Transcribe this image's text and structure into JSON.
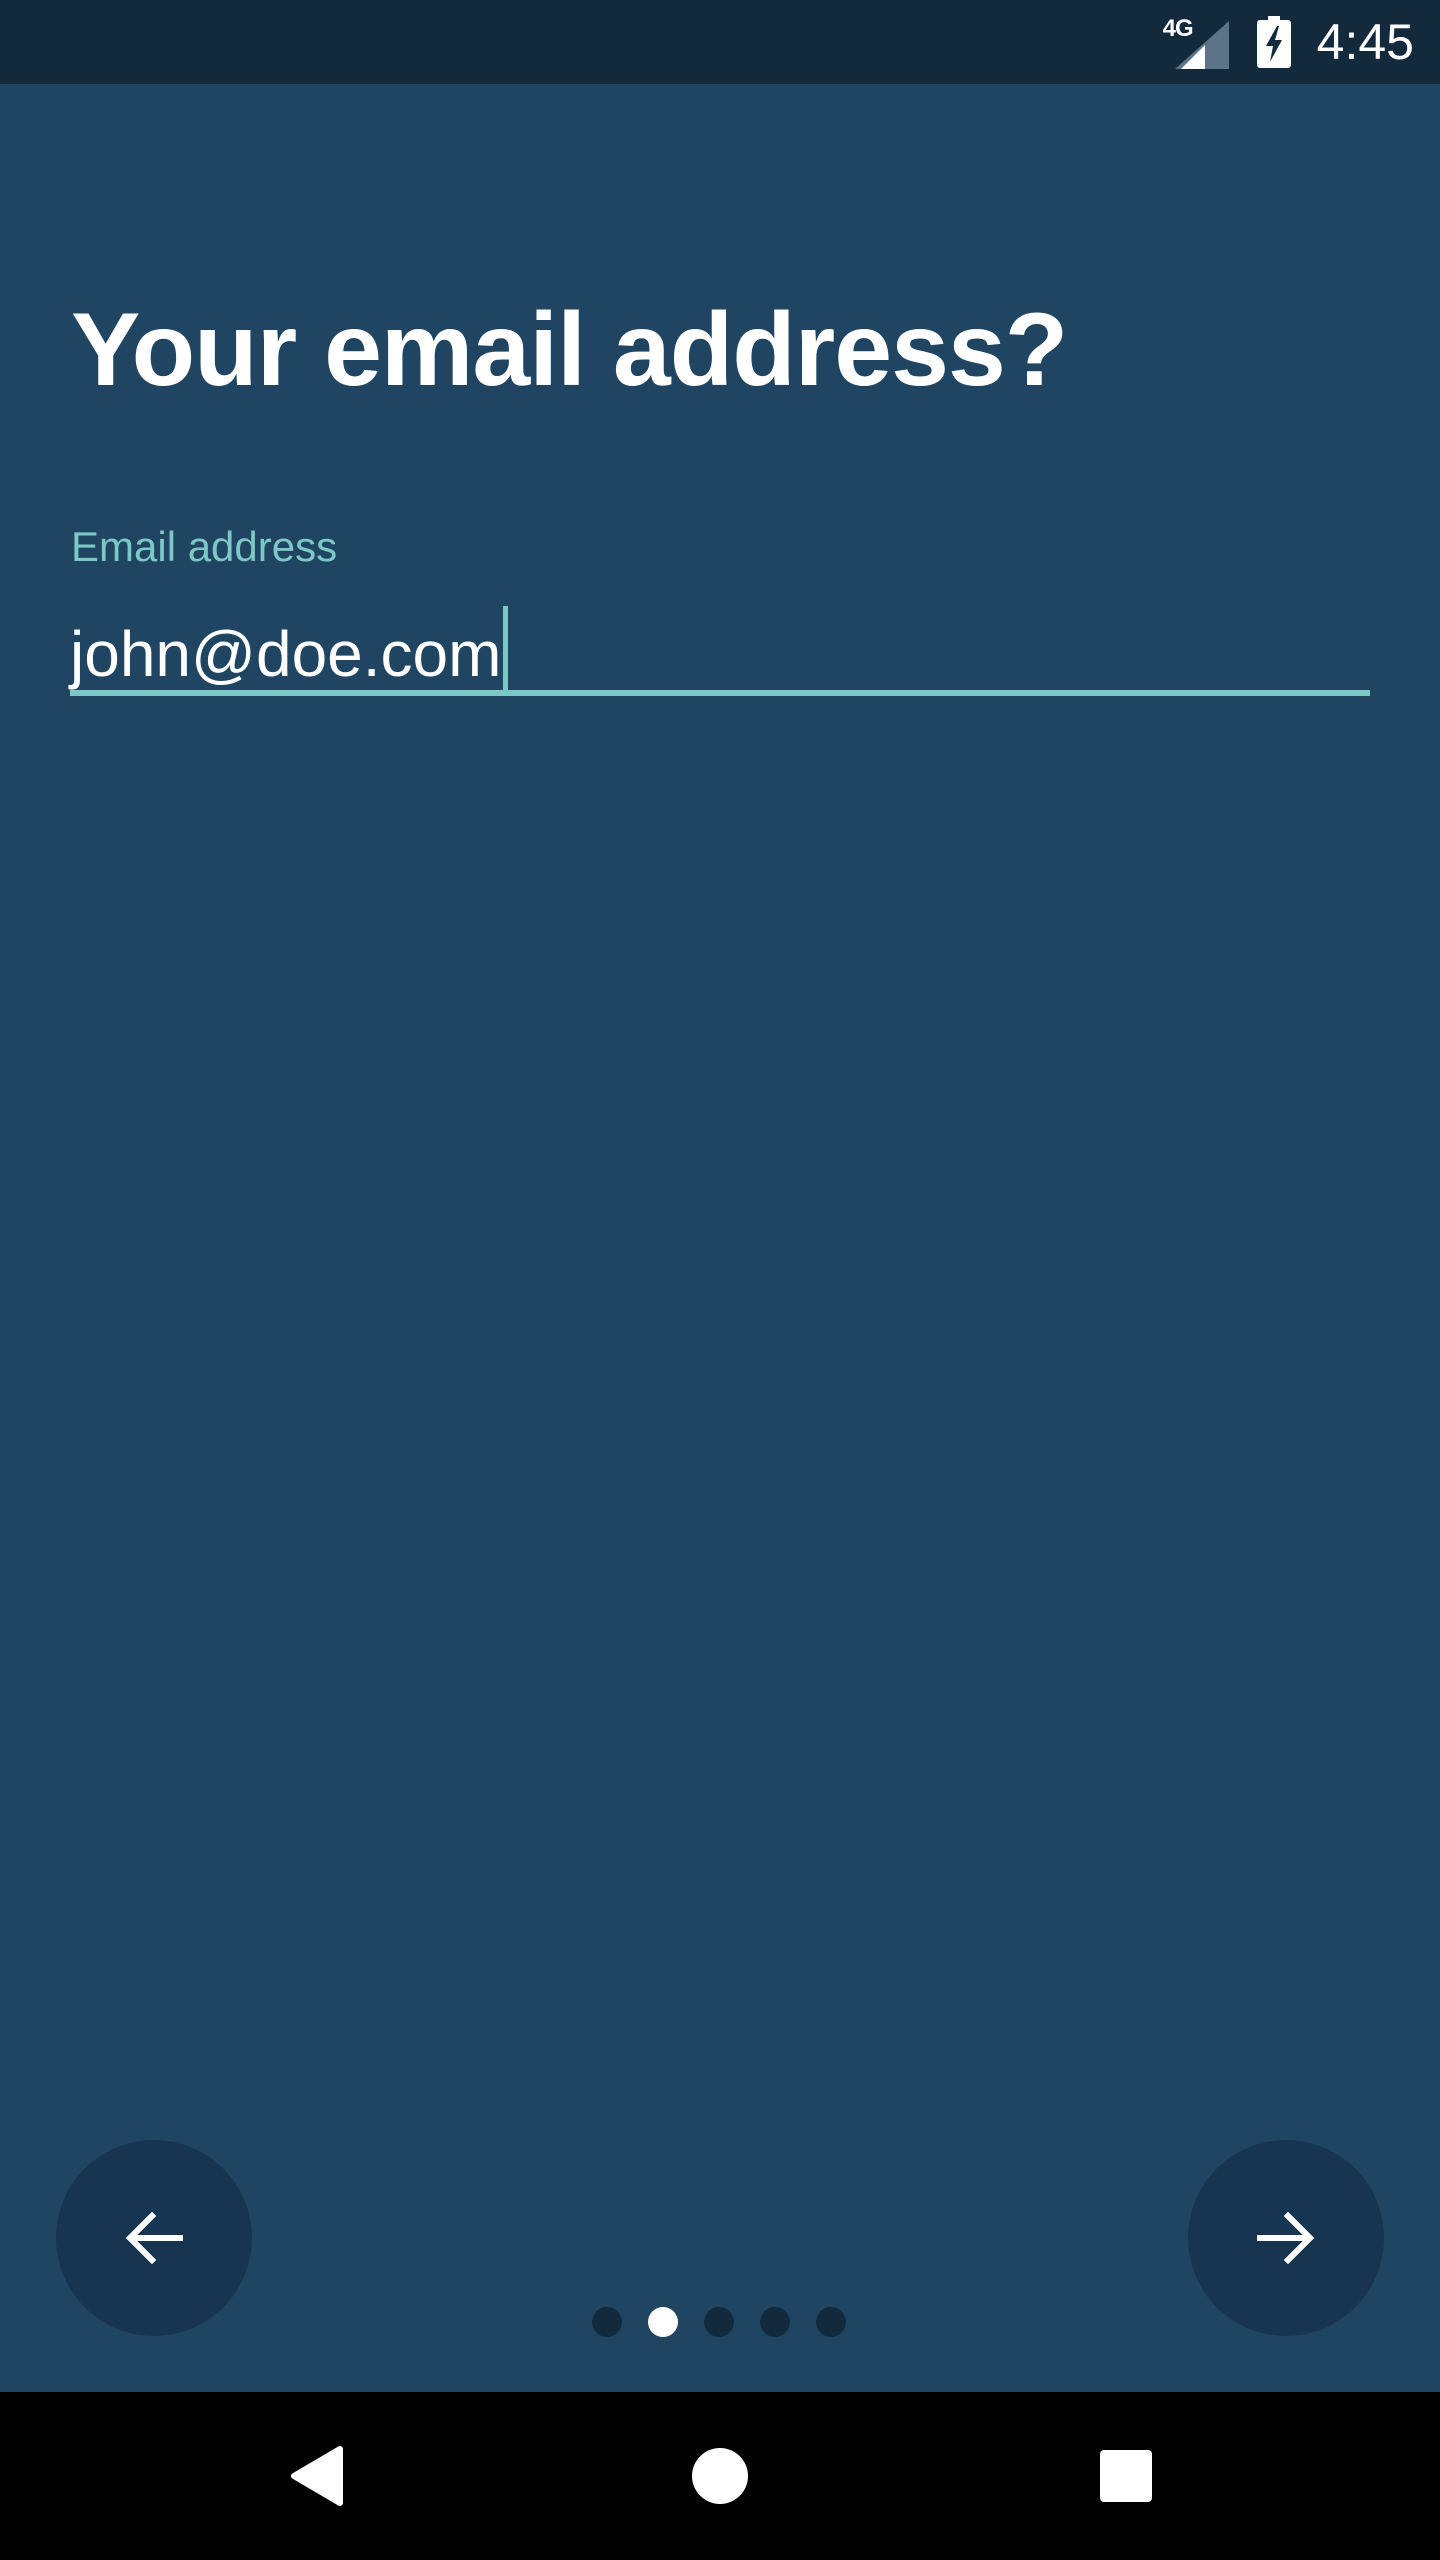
{
  "status_bar": {
    "network_type": "4G",
    "signal_icon": "cell-signal-icon",
    "battery_icon": "battery-charging-icon",
    "time": "4:45"
  },
  "title": "Your email address?",
  "email_field": {
    "label": "Email address",
    "value": "john@doe.com"
  },
  "navigation": {
    "back_icon": "arrow-left-icon",
    "next_icon": "arrow-right-icon"
  },
  "pager": {
    "total": 5,
    "active_index": 1
  },
  "system_nav": {
    "back_icon": "triangle-back-icon",
    "home_icon": "circle-home-icon",
    "recents_icon": "square-recents-icon"
  },
  "colors": {
    "background": "#204562",
    "status_bar": "#132a3d",
    "accent": "#7cc8c5",
    "button": "#173450"
  }
}
